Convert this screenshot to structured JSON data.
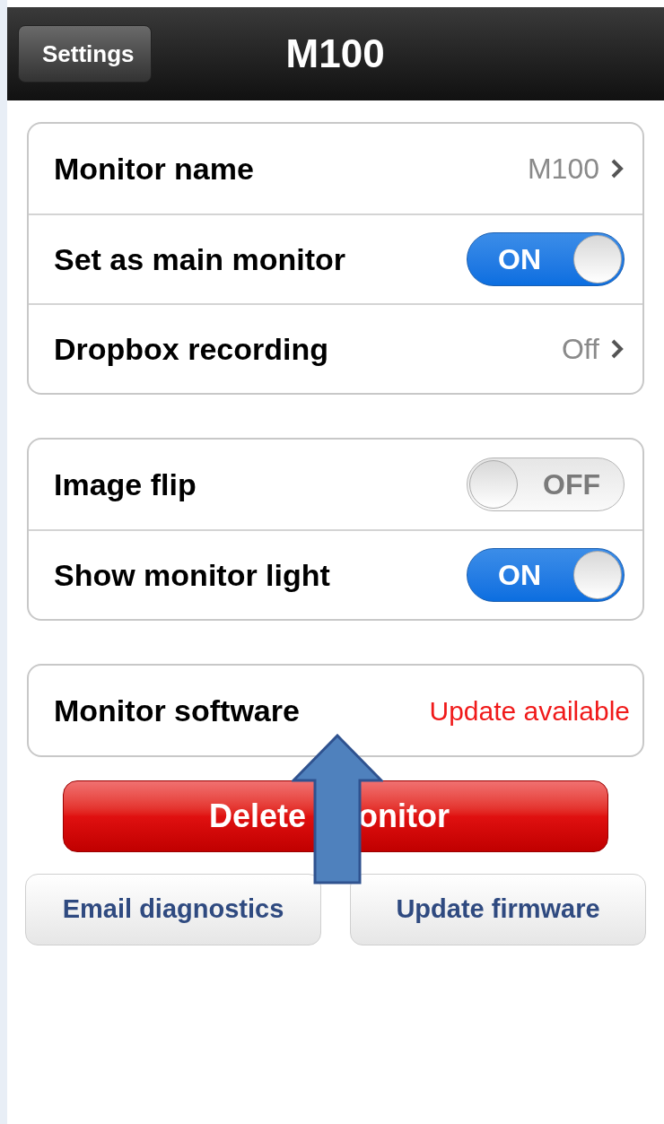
{
  "nav": {
    "back": "Settings",
    "title": "M100"
  },
  "groups": [
    {
      "rows": [
        {
          "kind": "link",
          "label": "Monitor name",
          "value": "M100"
        },
        {
          "kind": "toggle",
          "label": "Set as main monitor",
          "on": true,
          "text": "ON"
        },
        {
          "kind": "link",
          "label": "Dropbox recording",
          "value": "Off"
        }
      ]
    },
    {
      "rows": [
        {
          "kind": "toggle",
          "label": "Image flip",
          "on": false,
          "text": "OFF"
        },
        {
          "kind": "toggle",
          "label": "Show monitor light",
          "on": true,
          "text": "ON"
        }
      ]
    },
    {
      "rows": [
        {
          "kind": "status",
          "label": "Monitor software",
          "value": "Update available"
        }
      ]
    }
  ],
  "delete_button": {
    "left_text": "Delete",
    "right_text": "onitor"
  },
  "buttons": [
    "Email diagnostics",
    "Update firmware"
  ]
}
